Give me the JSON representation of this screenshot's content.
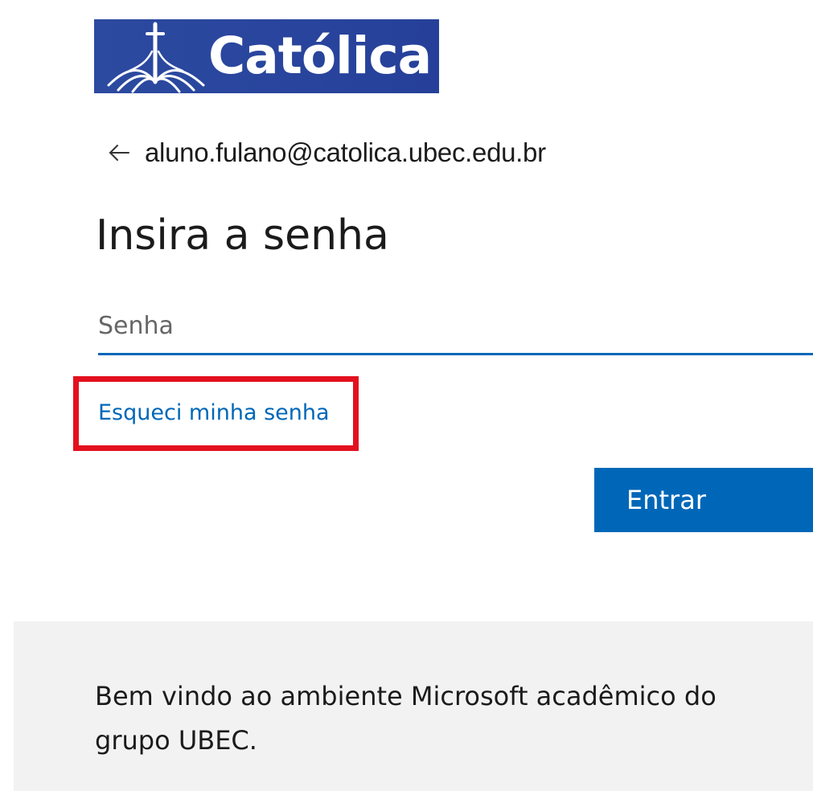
{
  "brand": {
    "logo_text": "Católica",
    "logo_color": "#2c4aa0"
  },
  "identity": {
    "back_icon": "arrow-left-icon",
    "email": "aluno.fulano@catolica.ubec.edu.br"
  },
  "main": {
    "title": "Insira a senha",
    "password_placeholder": "Senha",
    "password_value": "",
    "forgot_link": "Esqueci minha senha",
    "submit_label": "Entrar"
  },
  "banner": {
    "text": "Bem vindo ao ambiente Microsoft acadêmico do grupo UBEC."
  },
  "colors": {
    "accent": "#0067b8",
    "highlight": "#e3101e",
    "banner_bg": "#f2f2f2"
  }
}
